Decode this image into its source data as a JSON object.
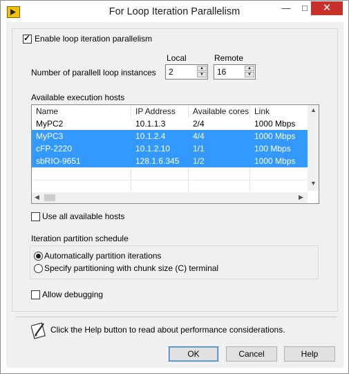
{
  "window": {
    "title": "For Loop Iteration Parallelism",
    "minimize_glyph": "—",
    "maximize_glyph": "□",
    "close_glyph": "✕"
  },
  "enable": {
    "label": "Enable loop iteration parallelism",
    "checked": true
  },
  "instances": {
    "label": "Number of parallell loop instances",
    "local_label": "Local",
    "remote_label": "Remote",
    "local_value": "2",
    "remote_value": "16"
  },
  "hosts": {
    "section_label": "Available execution hosts",
    "columns": [
      "Name",
      "IP Address",
      "Available cores",
      "Link"
    ],
    "rows": [
      [
        "MyPC2",
        "10.1.1.3",
        "2/4",
        "1000 Mbps"
      ],
      [
        "MyPC3",
        "10.1.2.4",
        "4/4",
        "1000 Mbps"
      ],
      [
        "cFP-2220",
        "10.1.2.10",
        "1/1",
        "100 Mbps"
      ],
      [
        "sbRIO-9651",
        "128.1.6.345",
        "1/2",
        "1000 Mbps"
      ]
    ],
    "selected_rows": [
      1,
      2,
      3
    ],
    "use_all_label": "Use all available hosts",
    "use_all_checked": false
  },
  "partition": {
    "section_label": "Iteration partition schedule",
    "options": [
      "Automatically partition iterations",
      "Specify partitioning with chunk size (C) terminal"
    ],
    "selected": 0
  },
  "debugging": {
    "label": "Allow debugging",
    "checked": false
  },
  "help_text": "Click the Help button to read about performance considerations.",
  "buttons": {
    "ok": "OK",
    "cancel": "Cancel",
    "help": "Help"
  },
  "colors": {
    "selection": "#3399ff",
    "close_button": "#c7302b",
    "dialog_bg": "#f0f0f0"
  }
}
